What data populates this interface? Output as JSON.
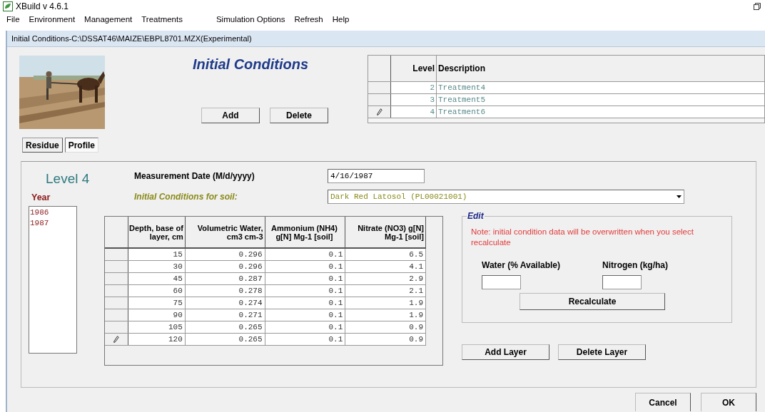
{
  "app": {
    "title": "XBuild v 4.6.1"
  },
  "menu": [
    [
      {
        "label": "File"
      },
      {
        "label": "Environment"
      },
      {
        "label": "Management"
      },
      {
        "label": "Treatments"
      }
    ],
    [
      {
        "label": "Simulation Options"
      },
      {
        "label": "Refresh"
      },
      {
        "label": "Help"
      }
    ]
  ],
  "window": {
    "title": "Initial Conditions-C:\\DSSAT46\\MAIZE\\EBPL8701.MZX(Experimental)"
  },
  "heading": "Initial Conditions",
  "top_buttons": [
    {
      "label": "Add"
    },
    {
      "label": "Delete"
    }
  ],
  "levels_table": {
    "columns": [
      "Level",
      "Description"
    ],
    "rows": [
      {
        "level": "2",
        "description": "Treatment4",
        "editing": false
      },
      {
        "level": "3",
        "description": "Treatment5",
        "editing": false
      },
      {
        "level": "4",
        "description": "Treatment6",
        "editing": true
      }
    ]
  },
  "tabs": [
    {
      "label": "Residue",
      "selected": false
    },
    {
      "label": "Profile",
      "selected": true
    }
  ],
  "level_title": "Level 4",
  "year": {
    "label": "Year",
    "items": [
      "1986",
      "1987"
    ]
  },
  "measurement_date": {
    "label": "Measurement Date (M/d/yyyy)",
    "value": "4/16/1987"
  },
  "soil": {
    "label": "Initial Conditions for soil:",
    "value": "Dark Red Latosol (PL00021001)"
  },
  "layers": {
    "columns": [
      "Depth, base of layer, cm",
      "Volumetric Water, cm3 cm-3",
      "Ammonium (NH4) g[N] Mg-1 [soil]",
      "Nitrate (NO3) g[N] Mg-1 [soil]"
    ],
    "rows": [
      {
        "cells": [
          "15",
          "0.296",
          "0.1",
          "6.5"
        ],
        "editing": false
      },
      {
        "cells": [
          "30",
          "0.296",
          "0.1",
          "4.1"
        ],
        "editing": false
      },
      {
        "cells": [
          "45",
          "0.287",
          "0.1",
          "2.9"
        ],
        "editing": false
      },
      {
        "cells": [
          "60",
          "0.278",
          "0.1",
          "2.1"
        ],
        "editing": false
      },
      {
        "cells": [
          "75",
          "0.274",
          "0.1",
          "1.9"
        ],
        "editing": false
      },
      {
        "cells": [
          "90",
          "0.271",
          "0.1",
          "1.9"
        ],
        "editing": false
      },
      {
        "cells": [
          "105",
          "0.265",
          "0.1",
          "0.9"
        ],
        "editing": false
      },
      {
        "cells": [
          "120",
          "0.265",
          "0.1",
          "0.9"
        ],
        "editing": true
      }
    ]
  },
  "edit": {
    "title": "Edit",
    "note": "Note: initial condition data will be overwritten when you select recalculate",
    "water": {
      "label": "Water (% Available)"
    },
    "nitrogen": {
      "label": "Nitrogen (kg/ha)"
    },
    "button": {
      "label": "Recalculate"
    }
  },
  "layer_buttons": [
    {
      "label": "Add Layer"
    },
    {
      "label": "Delete Layer"
    }
  ],
  "dialog_buttons": [
    {
      "label": "Cancel"
    },
    {
      "label": "OK"
    }
  ]
}
